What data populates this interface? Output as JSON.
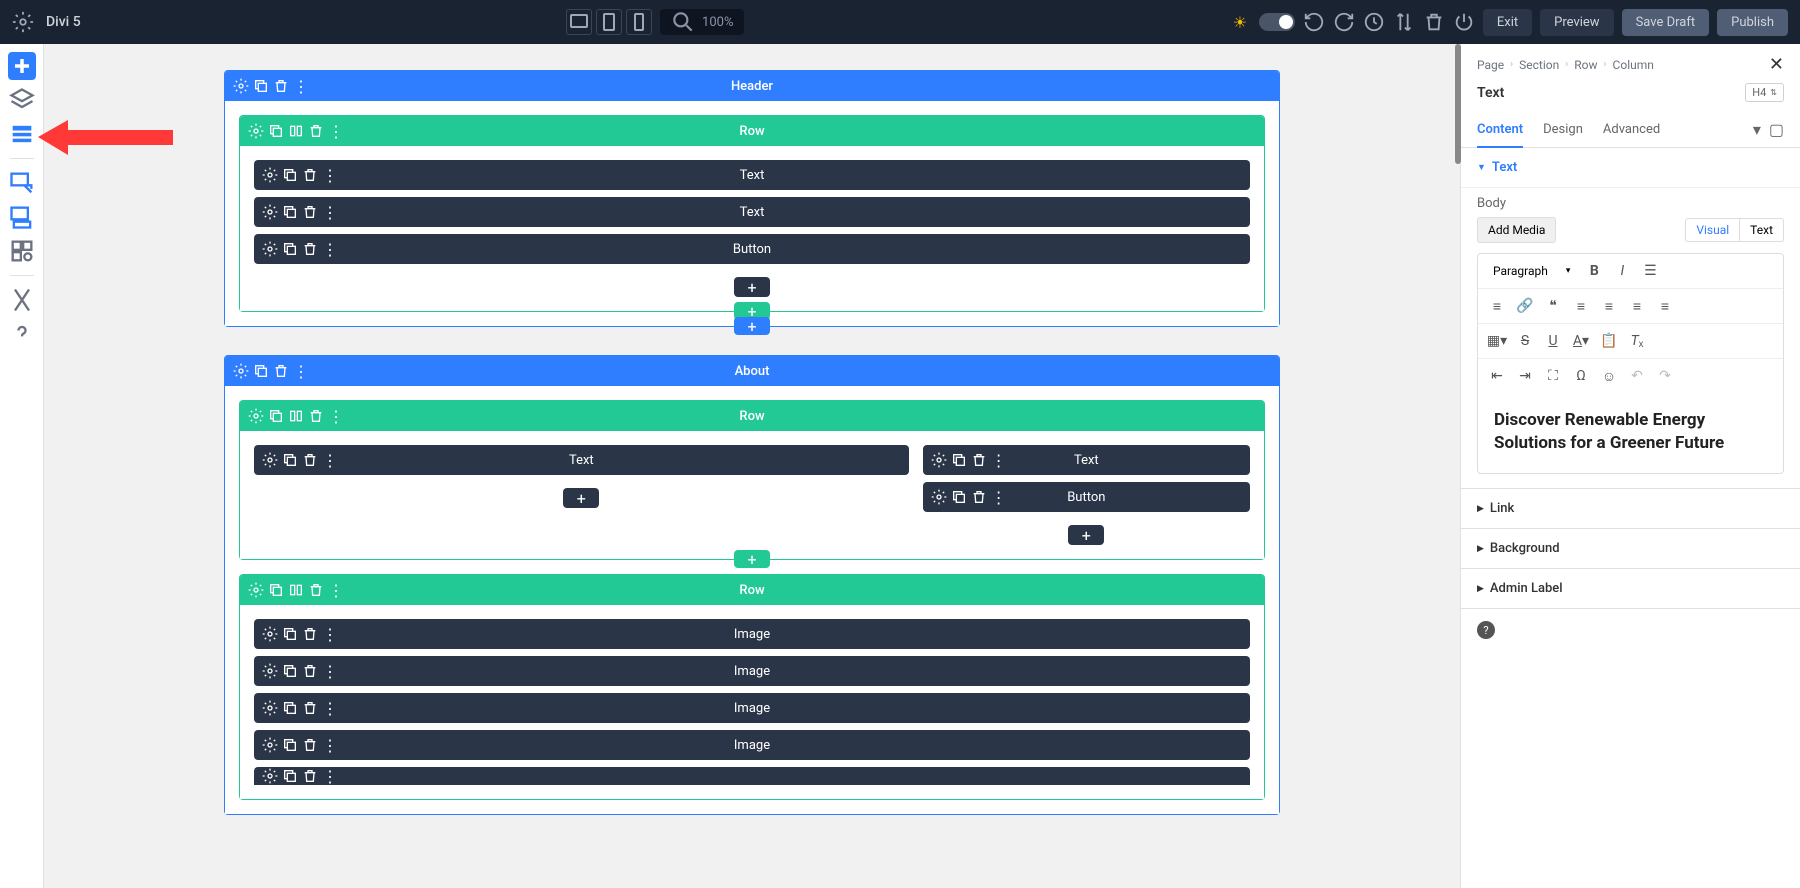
{
  "topbar": {
    "title": "Divi 5",
    "zoom": "100%",
    "exit": "Exit",
    "preview": "Preview",
    "save_draft": "Save Draft",
    "publish": "Publish"
  },
  "sections": [
    {
      "name": "Header",
      "rows": [
        {
          "name": "Row",
          "columns": [
            {
              "modules": [
                "Text",
                "Text",
                "Button"
              ]
            }
          ]
        }
      ]
    },
    {
      "name": "About",
      "rows": [
        {
          "name": "Row",
          "columns": [
            {
              "modules": [
                "Text"
              ]
            },
            {
              "modules": [
                "Text",
                "Button"
              ]
            }
          ]
        },
        {
          "name": "Row",
          "columns": [
            {
              "modules": [
                "Image",
                "Image",
                "Image",
                "Image"
              ]
            }
          ]
        }
      ]
    }
  ],
  "rightPanel": {
    "breadcrumb": [
      "Page",
      "Section",
      "Row",
      "Column"
    ],
    "title": "Text",
    "badge": "H4",
    "tabs": {
      "content": "Content",
      "design": "Design",
      "advanced": "Advanced"
    },
    "textSection": "Text",
    "bodyLabel": "Body",
    "addMedia": "Add Media",
    "editorTabs": {
      "visual": "Visual",
      "text": "Text"
    },
    "paragraphSelect": "Paragraph",
    "editorContent": "Discover Renewable Energy Solutions for a Greener Future",
    "collapsed": {
      "link": "Link",
      "background": "Background",
      "adminLabel": "Admin Label"
    }
  }
}
